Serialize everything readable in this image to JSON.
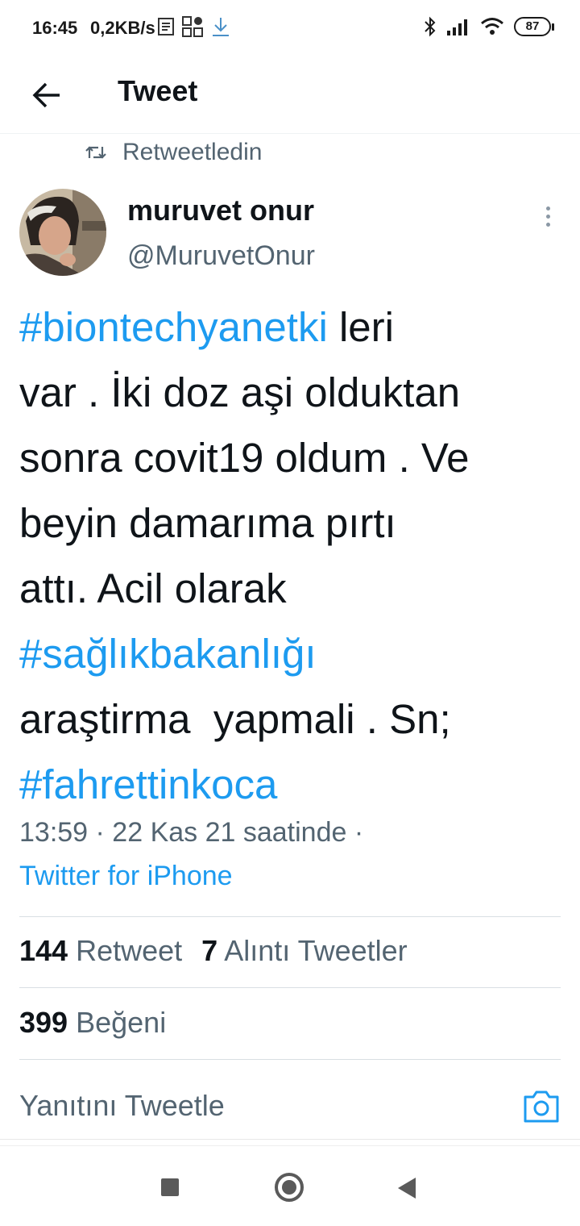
{
  "status_bar": {
    "time": "16:45",
    "net_speed": "0,2KB/s",
    "battery": "87"
  },
  "header": {
    "title": "Tweet"
  },
  "retweet": {
    "label": "Retweetledin"
  },
  "author": {
    "name": "muruvet onur",
    "handle": "@MuruvetOnur"
  },
  "tweet": {
    "lines": [
      {
        "hashtag": "#biontechyanetki",
        "text": " leri"
      },
      {
        "text": "var . İki doz aşi olduktan"
      },
      {
        "text": "sonra covit19 oldum . Ve"
      },
      {
        "text": "beyin damarıma pırtı"
      },
      {
        "text": "attı. Acil olarak"
      },
      {
        "hashtag": "#sağlıkbakanlığı"
      },
      {
        "text": "araştirma  yapmali . Sn;"
      },
      {
        "hashtag": "#fahrettinkoca"
      }
    ],
    "timestamp": "13:59 · 22 Kas 21 saatinde ·",
    "source": "Twitter for iPhone"
  },
  "stats": {
    "retweets_count": "144",
    "retweets_label": "Retweet",
    "quotes_count": "7",
    "quotes_label": "Alıntı Tweetler",
    "likes_count": "399",
    "likes_label": "Beğeni"
  },
  "reply": {
    "placeholder": "Yanıtını Tweetle"
  },
  "colors": {
    "accent": "#1d9bf0",
    "secondary_text": "#536471",
    "primary_text": "#0f1419"
  }
}
